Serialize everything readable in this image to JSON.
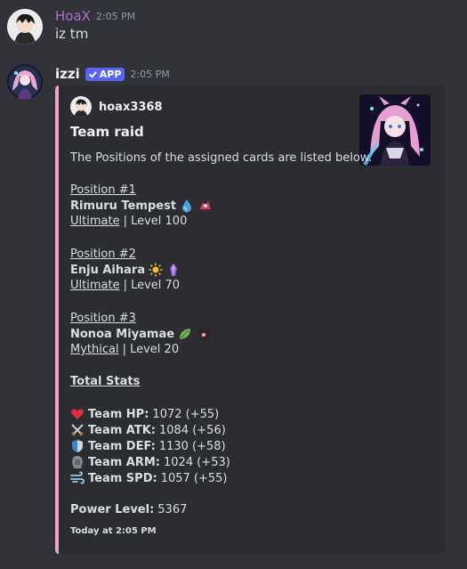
{
  "messages": [
    {
      "username": "HoaX",
      "username_color": "#b06fc6",
      "time": "2:05 PM",
      "text": "iz tm"
    },
    {
      "username": "izzi",
      "badge": "APP",
      "time": "2:05 PM",
      "embed": {
        "author": "hoax3368",
        "title": "Team raid",
        "description": "The Positions of the assigned cards are listed below.",
        "accent_color": "#eba3c8",
        "positions": [
          {
            "label": "Position #1",
            "name": "Rimuru Tempest",
            "rarity": "Ultimate",
            "level": "| Level 100",
            "element_icon": "water-drop-icon"
          },
          {
            "label": "Position #2",
            "name": "Enju Aihara",
            "rarity": "Ultimate",
            "level": "| Level 70",
            "element_icon": "sun-icon"
          },
          {
            "label": "Position #3",
            "name": "Nonoa Miyamae",
            "rarity": "Mythical",
            "level": "| Level 20",
            "element_icon": "leaf-icon"
          }
        ],
        "stats_heading": "Total Stats",
        "stats": [
          {
            "icon": "heart-icon",
            "label": "Team HP:",
            "value": "1072 (+55)"
          },
          {
            "icon": "swords-icon",
            "label": "Team ATK:",
            "value": "1084 (+56)"
          },
          {
            "icon": "shield-icon",
            "label": "Team DEF:",
            "value": "1130 (+58)"
          },
          {
            "icon": "armor-icon",
            "label": "Team ARM:",
            "value": "1024 (+53)"
          },
          {
            "icon": "wind-icon",
            "label": "Team SPD:",
            "value": "1057 (+55)"
          }
        ],
        "power_label": "Power Level:",
        "power_value": "5367",
        "footer": "Today at 2:05 PM"
      }
    }
  ]
}
